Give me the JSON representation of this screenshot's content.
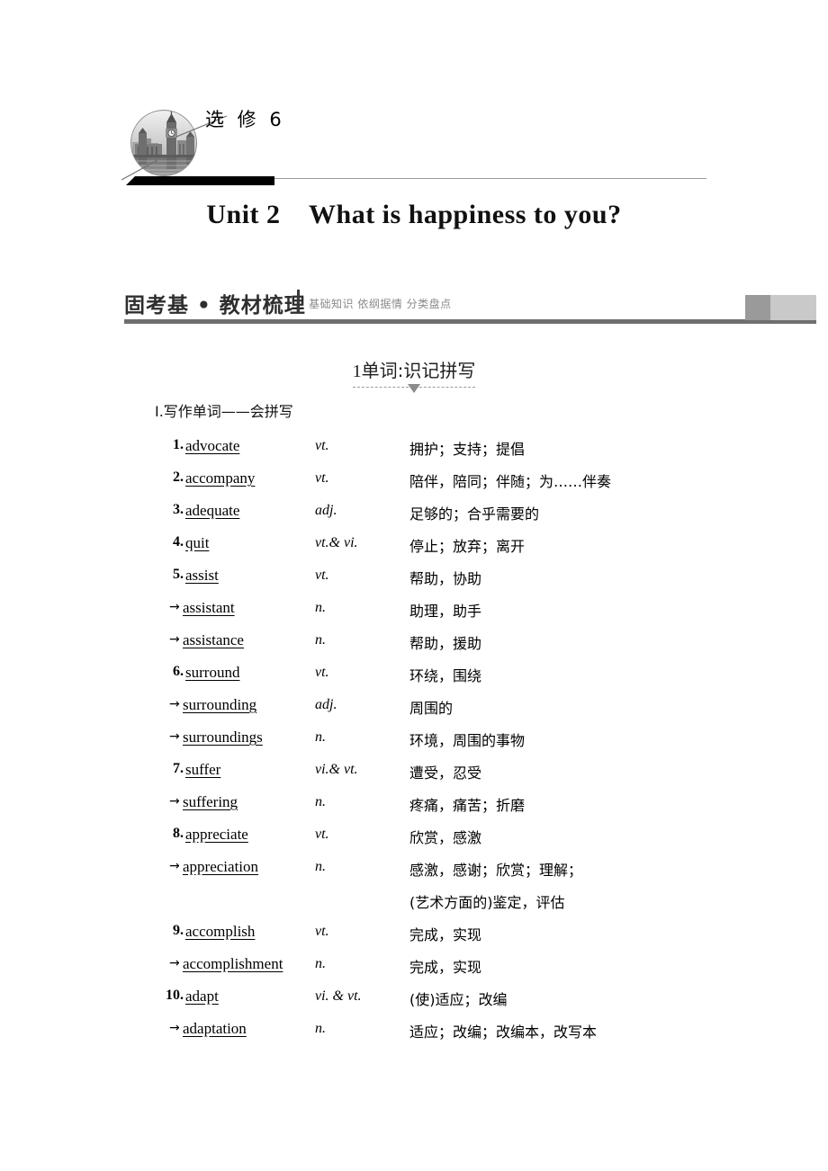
{
  "header": {
    "book_label": "选 修 6",
    "badge_icon": "big-ben-photo-icon"
  },
  "unit_title": "Unit 2    What is happiness to you?",
  "section_banner": {
    "main": "固考基 • 教材梳理",
    "subtitle": "基础知识 依纲据情 分类盘点"
  },
  "topic": {
    "number": "1",
    "label": "单词:识记拼写"
  },
  "subsection": {
    "label": "Ⅰ.写作单词——会拼写"
  },
  "words": [
    {
      "num": "1",
      "term": "advocate",
      "pos": "vt.",
      "def": "拥护；支持；提倡"
    },
    {
      "num": "2",
      "term": "accompany",
      "pos": "vt.",
      "def": "陪伴，陪同；伴随；为……伴奏"
    },
    {
      "num": "3",
      "term": "adequate",
      "pos": "adj.",
      "def": "足够的；合乎需要的"
    },
    {
      "num": "4",
      "term": "quit",
      "pos": "vt.& vi.",
      "def": "停止；放弃；离开"
    },
    {
      "num": "5",
      "term": "assist",
      "pos": "vt.",
      "def": "帮助，协助"
    },
    {
      "num": "",
      "term": "assistant",
      "pos": "n.",
      "def": "助理，助手",
      "derived": true
    },
    {
      "num": "",
      "term": "assistance",
      "pos": "n.",
      "def": "帮助，援助",
      "derived": true
    },
    {
      "num": "6",
      "term": "surround",
      "pos": "vt.",
      "def": "环绕，围绕"
    },
    {
      "num": "",
      "term": "surrounding",
      "pos": "adj.",
      "def": "周围的",
      "derived": true
    },
    {
      "num": "",
      "term": "surroundings",
      "pos": "n.",
      "def": "环境，周围的事物",
      "derived": true
    },
    {
      "num": "7",
      "term": "suffer",
      "pos": "vi.& vt.",
      "def": "遭受，忍受"
    },
    {
      "num": "",
      "term": "suffering",
      "pos": "n.",
      "def": "疼痛，痛苦；折磨",
      "derived": true
    },
    {
      "num": "8",
      "term": "appreciate",
      "pos": "vt.",
      "def": "欣赏，感激"
    },
    {
      "num": "",
      "term": "appreciation",
      "pos": "n.",
      "def": "感激，感谢；欣赏；理解；",
      "def2": "(艺术方面的)鉴定，评估",
      "derived": true
    },
    {
      "num": "9",
      "term": "accomplish",
      "pos": "vt.",
      "def": "完成，实现"
    },
    {
      "num": "",
      "term": "accomplishment",
      "pos": "n.",
      "def": "完成，实现",
      "derived": true
    },
    {
      "num": "10",
      "term": "adapt",
      "pos": "vi. & vt.",
      "def": "(使)适应；改编"
    },
    {
      "num": "",
      "term": "adaptation",
      "pos": "n.",
      "def": "适应；改编；改编本，改写本",
      "derived": true
    }
  ],
  "arrow_glyph": "→",
  "colors": {
    "rule_dark": "#6f6f6f",
    "rule_thin": "#9a9a9a",
    "banner_sub": "#8a8a8a",
    "block_dark": "#9a9a9a",
    "block_light": "#c9c9c9"
  }
}
